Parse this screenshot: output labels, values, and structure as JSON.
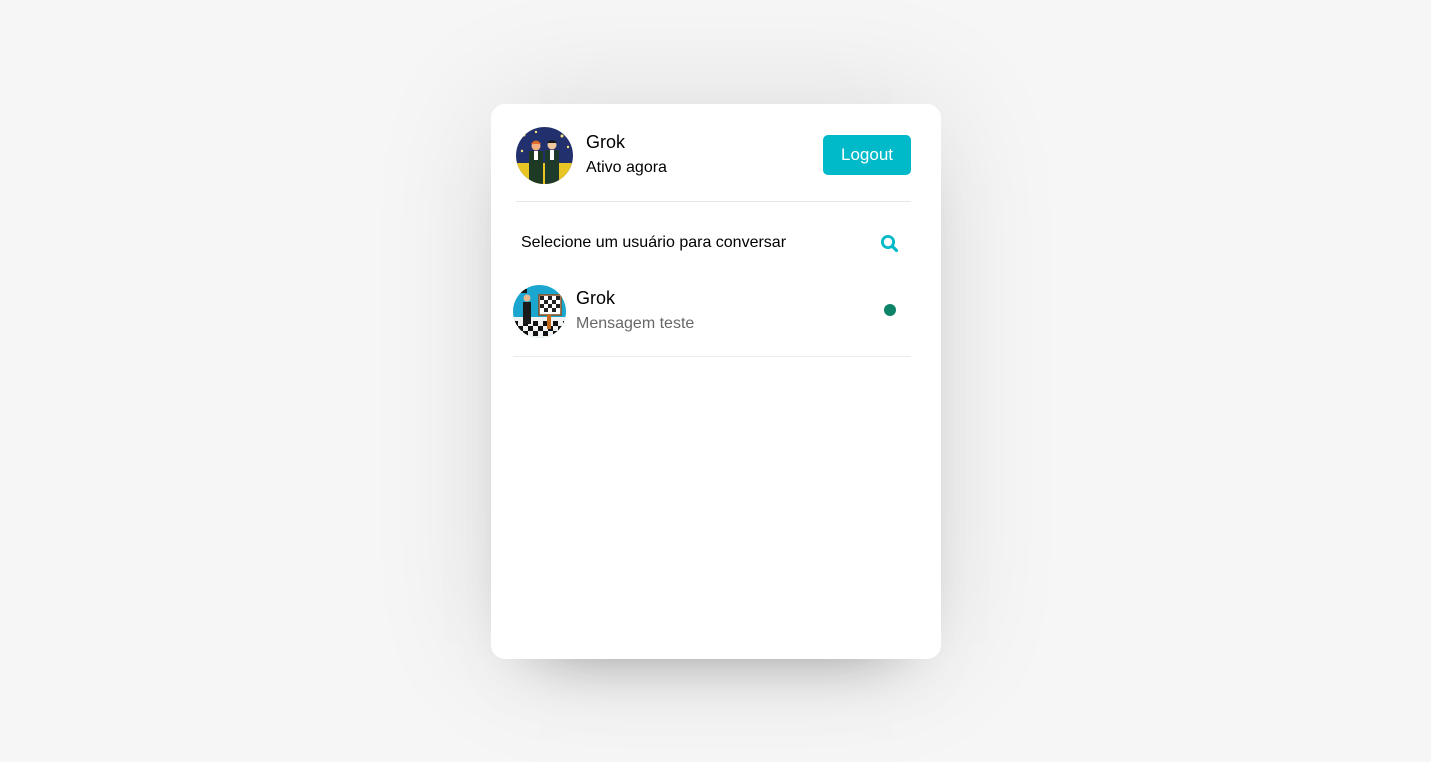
{
  "header": {
    "user_name": "Grok",
    "user_status": "Ativo agora",
    "logout_label": "Logout"
  },
  "search": {
    "title": "Selecione um usuário para conversar",
    "icon": "search-icon"
  },
  "users": [
    {
      "name": "Grok",
      "last_message": "Mensagem teste",
      "online": true
    }
  ],
  "colors": {
    "accent": "#00b9c9",
    "online": "#0d8368",
    "muted_text": "#67676a",
    "background": "#f6f6f6"
  }
}
